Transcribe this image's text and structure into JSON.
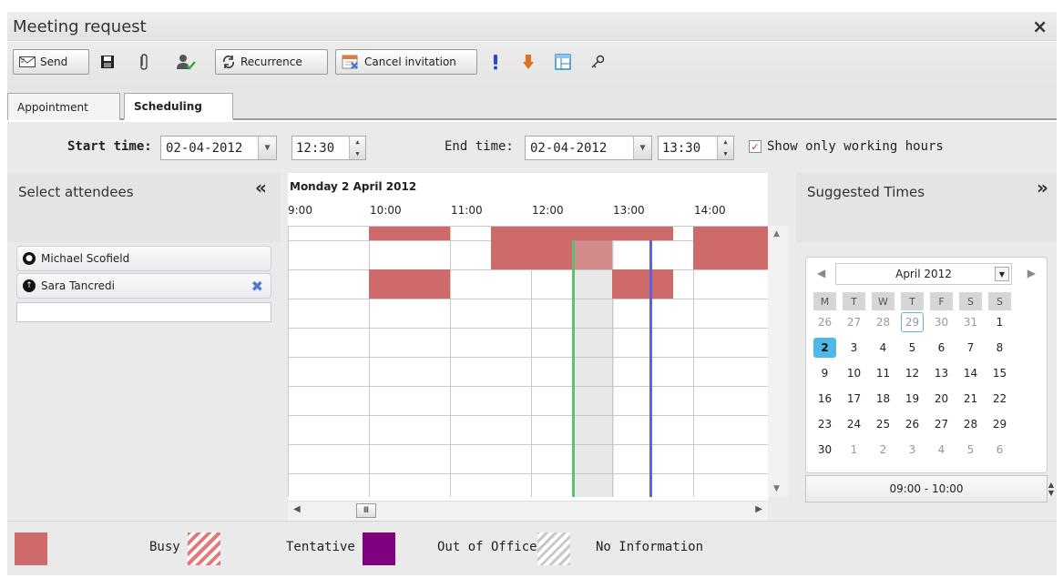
{
  "window": {
    "title": "Meeting request",
    "close_glyph": "×"
  },
  "toolbar": {
    "send_label": "Send",
    "recurrence_label": "Recurrence",
    "cancel_label": "Cancel invitation",
    "icons": [
      "envelope-icon",
      "save-icon",
      "attachment-icon",
      "check-names-icon",
      "recurrence-icon",
      "calendar-cancel-icon",
      "high-importance-icon",
      "low-importance-icon",
      "layout-icon",
      "key-icon"
    ]
  },
  "tabs": [
    {
      "label": "Appointment",
      "active": false
    },
    {
      "label": "Scheduling",
      "active": true
    }
  ],
  "times": {
    "start_label": "Start time:",
    "start_date": "02-04-2012",
    "start_time": "12:30",
    "end_label": "End time:",
    "end_date": "02-04-2012",
    "end_time": "13:30",
    "working_hours_label": "Show only working hours",
    "working_hours_checked": true
  },
  "attendees": {
    "title": "Select attendees",
    "collapse_glyph": "«",
    "people": [
      {
        "name": "Michael Scofield",
        "role_glyph": "●"
      },
      {
        "name": "Sara Tancredi",
        "role_glyph": "↑"
      }
    ]
  },
  "grid": {
    "day": "Monday 2 April 2012",
    "hours": [
      "9:00",
      "10:00",
      "11:00",
      "12:00",
      "13:00",
      "14:00"
    ]
  },
  "suggested": {
    "title": "Suggested Times",
    "expand_glyph": "»",
    "month": "April 2012",
    "dows": [
      "M",
      "T",
      "W",
      "T",
      "F",
      "S",
      "S"
    ],
    "weeks": [
      [
        "26",
        "27",
        "28",
        "29",
        "30",
        "31",
        "1"
      ],
      [
        "2",
        "3",
        "4",
        "5",
        "6",
        "7",
        "8"
      ],
      [
        "9",
        "10",
        "11",
        "12",
        "13",
        "14",
        "15"
      ],
      [
        "16",
        "17",
        "18",
        "19",
        "20",
        "21",
        "22"
      ],
      [
        "23",
        "24",
        "25",
        "26",
        "27",
        "28",
        "29"
      ],
      [
        "30",
        "1",
        "2",
        "3",
        "4",
        "5",
        "6"
      ]
    ],
    "slot": "09:00 - 10:00"
  },
  "legend": {
    "busy": "Busy",
    "tentative": "Tentative",
    "out_of_office": "Out of Office",
    "no_information": "No Information",
    "busy_color": "#cd6b6b",
    "out_of_office_color": "#800080"
  }
}
